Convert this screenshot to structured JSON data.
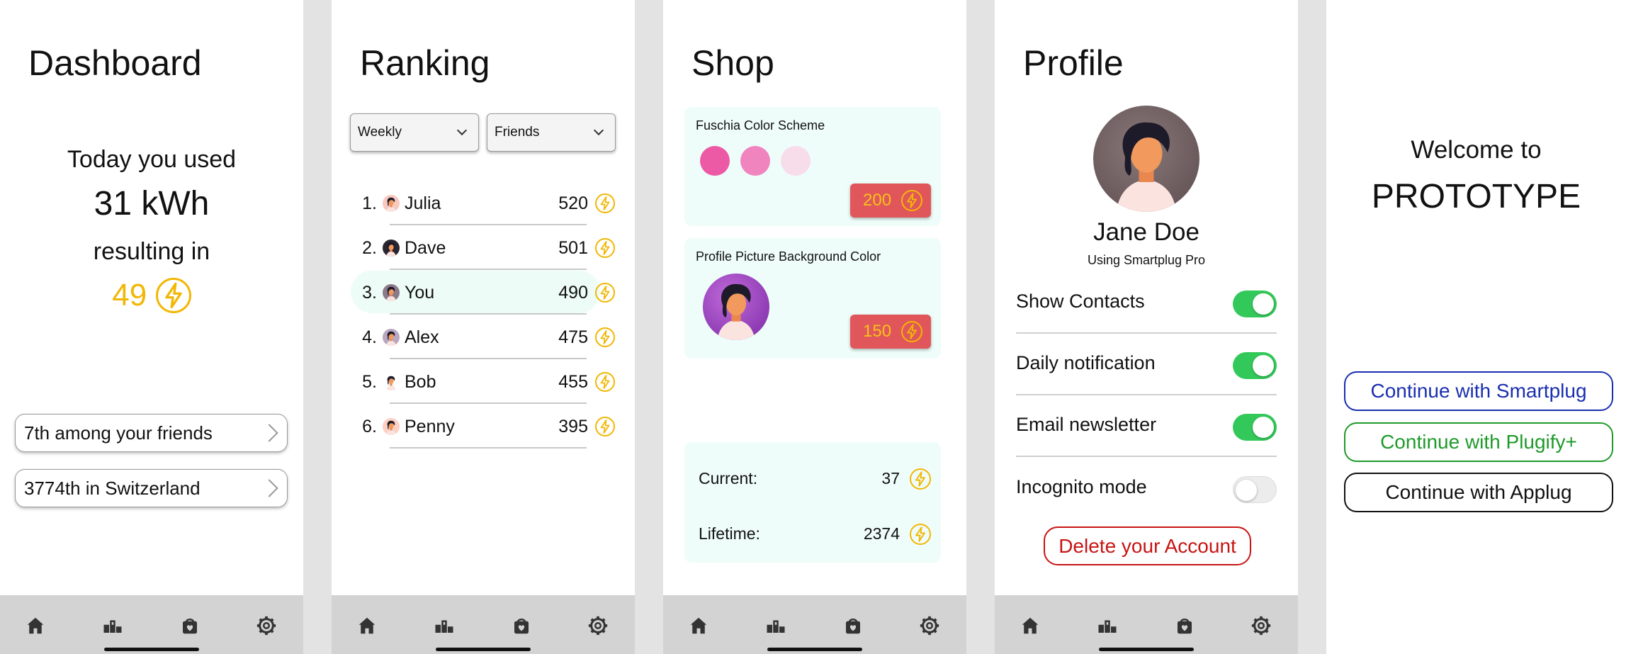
{
  "colors": {
    "accent": "#f2b705",
    "green": "#33c95a",
    "danger": "#c81414",
    "mint": "#effdfa"
  },
  "tabbar": {
    "icons": [
      "home-icon",
      "podium-icon",
      "shopping-bag-icon",
      "gear-icon"
    ]
  },
  "dashboard": {
    "title": "Dashboard",
    "used_label": "Today you used",
    "energy": "31 kWh",
    "resulting": "resulting in",
    "points": "49",
    "friends_rank": "7th among your friends",
    "country_rank": "3774th in Switzerland"
  },
  "ranking": {
    "title": "Ranking",
    "period": "Weekly",
    "scope": "Friends",
    "rows": [
      {
        "rank": "1.",
        "name": "Julia",
        "points": "520"
      },
      {
        "rank": "2.",
        "name": "Dave",
        "points": "501"
      },
      {
        "rank": "3.",
        "name": "You",
        "points": "490"
      },
      {
        "rank": "4.",
        "name": "Alex",
        "points": "475"
      },
      {
        "rank": "5.",
        "name": "Bob",
        "points": "455"
      },
      {
        "rank": "6.",
        "name": "Penny",
        "points": "395"
      }
    ]
  },
  "shop": {
    "title": "Shop",
    "items": [
      {
        "name": "Fuschia Color Scheme",
        "price": "200",
        "swatches": [
          "#ec5aa6",
          "#ef84bf",
          "#f7dcea"
        ]
      },
      {
        "name": "Profile Picture Background Color",
        "price": "150"
      }
    ],
    "current_label": "Current:",
    "current_value": "37",
    "lifetime_label": "Lifetime:",
    "lifetime_value": "2374"
  },
  "profile": {
    "title": "Profile",
    "name": "Jane Doe",
    "subtitle": "Using Smartplug Pro",
    "settings": [
      {
        "label": "Show Contacts",
        "on": true
      },
      {
        "label": "Daily notification",
        "on": true
      },
      {
        "label": "Email newsletter",
        "on": true
      },
      {
        "label": "Incognito mode",
        "on": false
      }
    ],
    "delete_label": "Delete your Account"
  },
  "welcome": {
    "line1": "Welcome to",
    "line2": "PROTOTYPE",
    "buttons": [
      {
        "label": "Continue with Smartplug",
        "color": "#1a2fb0"
      },
      {
        "label": "Continue with Plugify+",
        "color": "#1f9a2a"
      },
      {
        "label": "Continue with Applug",
        "color": "#111111"
      }
    ]
  }
}
